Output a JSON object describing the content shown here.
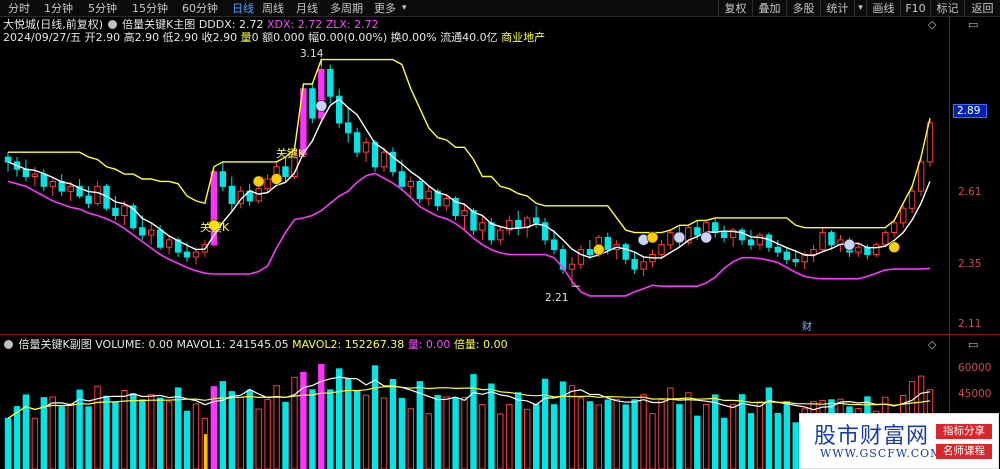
{
  "toolbar": {
    "periods": [
      "分时",
      "1分钟",
      "5分钟",
      "15分钟",
      "60分钟",
      "日线",
      "周线",
      "月线",
      "多周期",
      "更多"
    ],
    "active_period": "日线",
    "tools": [
      "复权",
      "叠加",
      "多股",
      "统计",
      "画线",
      "F10",
      "标记",
      "返回"
    ]
  },
  "main_info": {
    "stock": "大悦城(日线,前复权)",
    "indicator": "倍量关键K主图",
    "dddx": "DDDX: 2.72",
    "xdx": "XDX: 2.72",
    "zlx": "ZLX: 2.72"
  },
  "quote": {
    "date": "2024/09/27/五",
    "open_label": "开",
    "open": "2.90",
    "high_label": "高",
    "high": "2.90",
    "low_label": "低",
    "low": "2.90",
    "close_label": "收",
    "close": "2.90",
    "vol_label": "量",
    "vol": "0",
    "amount_label": "额",
    "amount": "0.000",
    "change_label": "幅",
    "change": "0.00(0.00%)",
    "turnover_label": "换",
    "turnover": "0.00%",
    "float_label": "流通",
    "float": "40.0亿",
    "sector": "商业地产"
  },
  "price_axis": {
    "ticks": [
      "2.61",
      "2.35",
      "2.11"
    ],
    "current": "2.89"
  },
  "annotations": {
    "high": "3.14",
    "low": "2.21",
    "key_k_1": "关键K",
    "key_k_2": "关键K",
    "fin_marker": "财"
  },
  "sub_info": {
    "indicator": "倍量关键K副图",
    "volume": "VOLUME: 0.00",
    "mavol1": "MAVOL1: 241545.05",
    "mavol2": "MAVOL2: 152267.38",
    "bei_label": "量: 0.00",
    "bei_vol": "倍量: 0.00"
  },
  "volume_axis": {
    "ticks": [
      "60000",
      "45000"
    ]
  },
  "watermark": {
    "logo": "股市财富网",
    "url": "WWW.GSCFW.COM",
    "tag1": "指标分享",
    "tag2": "名师课程"
  },
  "colors": {
    "up": "#ff3b3b",
    "down": "#00e5e5",
    "yellow_line": "#ffff33",
    "white_line": "#ffffff",
    "magenta_line": "#ff33ff",
    "highlight_bar": "#ff33ff",
    "bei_bar": "#ffcc00"
  },
  "chart_data": {
    "type": "candlestick",
    "title": "倍量关键K主图",
    "ylim": [
      2.03,
      3.2
    ],
    "candles": [
      [
        2.74,
        2.76,
        2.68,
        2.72
      ],
      [
        2.72,
        2.74,
        2.66,
        2.69
      ],
      [
        2.69,
        2.73,
        2.64,
        2.66
      ],
      [
        2.66,
        2.7,
        2.62,
        2.67
      ],
      [
        2.67,
        2.69,
        2.6,
        2.62
      ],
      [
        2.62,
        2.66,
        2.58,
        2.64
      ],
      [
        2.64,
        2.67,
        2.58,
        2.6
      ],
      [
        2.6,
        2.64,
        2.56,
        2.62
      ],
      [
        2.62,
        2.65,
        2.57,
        2.58
      ],
      [
        2.58,
        2.62,
        2.53,
        2.55
      ],
      [
        2.55,
        2.64,
        2.54,
        2.62
      ],
      [
        2.62,
        2.63,
        2.52,
        2.53
      ],
      [
        2.53,
        2.58,
        2.48,
        2.5
      ],
      [
        2.5,
        2.56,
        2.46,
        2.54
      ],
      [
        2.54,
        2.55,
        2.44,
        2.45
      ],
      [
        2.45,
        2.5,
        2.4,
        2.42
      ],
      [
        2.42,
        2.47,
        2.38,
        2.44
      ],
      [
        2.44,
        2.46,
        2.36,
        2.37
      ],
      [
        2.37,
        2.42,
        2.34,
        2.4
      ],
      [
        2.4,
        2.41,
        2.33,
        2.35
      ],
      [
        2.35,
        2.39,
        2.31,
        2.33
      ],
      [
        2.33,
        2.37,
        2.3,
        2.35
      ],
      [
        2.35,
        2.4,
        2.33,
        2.38
      ],
      [
        2.38,
        2.7,
        2.37,
        2.68
      ],
      [
        2.68,
        2.72,
        2.6,
        2.62
      ],
      [
        2.62,
        2.66,
        2.52,
        2.55
      ],
      [
        2.55,
        2.62,
        2.53,
        2.6
      ],
      [
        2.6,
        2.63,
        2.54,
        2.56
      ],
      [
        2.56,
        2.62,
        2.55,
        2.61
      ],
      [
        2.61,
        2.67,
        2.59,
        2.65
      ],
      [
        2.65,
        2.72,
        2.63,
        2.7
      ],
      [
        2.7,
        2.74,
        2.64,
        2.66
      ],
      [
        2.66,
        2.77,
        2.65,
        2.75
      ],
      [
        2.75,
        3.04,
        2.74,
        3.02
      ],
      [
        3.02,
        3.04,
        2.88,
        2.9
      ],
      [
        2.9,
        3.14,
        2.88,
        3.1
      ],
      [
        3.1,
        3.12,
        2.96,
        2.99
      ],
      [
        2.99,
        3.02,
        2.86,
        2.88
      ],
      [
        2.88,
        2.94,
        2.8,
        2.84
      ],
      [
        2.84,
        2.86,
        2.74,
        2.76
      ],
      [
        2.76,
        2.82,
        2.72,
        2.8
      ],
      [
        2.8,
        2.81,
        2.68,
        2.7
      ],
      [
        2.7,
        2.78,
        2.68,
        2.76
      ],
      [
        2.76,
        2.78,
        2.66,
        2.68
      ],
      [
        2.68,
        2.73,
        2.6,
        2.62
      ],
      [
        2.62,
        2.66,
        2.58,
        2.64
      ],
      [
        2.64,
        2.66,
        2.55,
        2.57
      ],
      [
        2.57,
        2.62,
        2.54,
        2.6
      ],
      [
        2.6,
        2.61,
        2.52,
        2.54
      ],
      [
        2.54,
        2.59,
        2.52,
        2.57
      ],
      [
        2.57,
        2.58,
        2.48,
        2.5
      ],
      [
        2.5,
        2.55,
        2.44,
        2.52
      ],
      [
        2.52,
        2.53,
        2.42,
        2.44
      ],
      [
        2.44,
        2.5,
        2.4,
        2.47
      ],
      [
        2.47,
        2.49,
        2.38,
        2.4
      ],
      [
        2.4,
        2.46,
        2.38,
        2.44
      ],
      [
        2.44,
        2.5,
        2.42,
        2.48
      ],
      [
        2.48,
        2.52,
        2.42,
        2.45
      ],
      [
        2.45,
        2.5,
        2.41,
        2.49
      ],
      [
        2.49,
        2.54,
        2.45,
        2.47
      ],
      [
        2.47,
        2.49,
        2.38,
        2.4
      ],
      [
        2.4,
        2.44,
        2.34,
        2.36
      ],
      [
        2.36,
        2.38,
        2.26,
        2.28
      ],
      [
        2.28,
        2.33,
        2.21,
        2.3
      ],
      [
        2.3,
        2.38,
        2.28,
        2.36
      ],
      [
        2.36,
        2.4,
        2.32,
        2.34
      ],
      [
        2.34,
        2.42,
        2.33,
        2.41
      ],
      [
        2.41,
        2.43,
        2.34,
        2.36
      ],
      [
        2.36,
        2.4,
        2.32,
        2.38
      ],
      [
        2.38,
        2.39,
        2.3,
        2.32
      ],
      [
        2.32,
        2.35,
        2.26,
        2.28
      ],
      [
        2.28,
        2.33,
        2.25,
        2.31
      ],
      [
        2.31,
        2.36,
        2.29,
        2.34
      ],
      [
        2.34,
        2.4,
        2.32,
        2.38
      ],
      [
        2.38,
        2.44,
        2.36,
        2.43
      ],
      [
        2.43,
        2.46,
        2.37,
        2.39
      ],
      [
        2.39,
        2.46,
        2.38,
        2.45
      ],
      [
        2.45,
        2.48,
        2.4,
        2.42
      ],
      [
        2.42,
        2.48,
        2.41,
        2.47
      ],
      [
        2.47,
        2.49,
        2.41,
        2.43
      ],
      [
        2.43,
        2.46,
        2.39,
        2.41
      ],
      [
        2.41,
        2.45,
        2.37,
        2.44
      ],
      [
        2.44,
        2.45,
        2.38,
        2.4
      ],
      [
        2.4,
        2.44,
        2.36,
        2.38
      ],
      [
        2.38,
        2.43,
        2.36,
        2.42
      ],
      [
        2.42,
        2.43,
        2.35,
        2.37
      ],
      [
        2.37,
        2.4,
        2.33,
        2.35
      ],
      [
        2.35,
        2.37,
        2.3,
        2.32
      ],
      [
        2.32,
        2.36,
        2.29,
        2.31
      ],
      [
        2.31,
        2.35,
        2.28,
        2.34
      ],
      [
        2.34,
        2.38,
        2.31,
        2.36
      ],
      [
        2.36,
        2.45,
        2.35,
        2.43
      ],
      [
        2.43,
        2.44,
        2.36,
        2.38
      ],
      [
        2.38,
        2.42,
        2.35,
        2.4
      ],
      [
        2.4,
        2.41,
        2.33,
        2.35
      ],
      [
        2.35,
        2.39,
        2.33,
        2.37
      ],
      [
        2.37,
        2.38,
        2.32,
        2.34
      ],
      [
        2.34,
        2.39,
        2.33,
        2.38
      ],
      [
        2.38,
        2.44,
        2.37,
        2.43
      ],
      [
        2.43,
        2.48,
        2.41,
        2.47
      ],
      [
        2.47,
        2.55,
        2.45,
        2.53
      ],
      [
        2.53,
        2.62,
        2.51,
        2.6
      ],
      [
        2.6,
        2.74,
        2.58,
        2.72
      ],
      [
        2.72,
        2.9,
        2.7,
        2.88
      ]
    ]
  }
}
